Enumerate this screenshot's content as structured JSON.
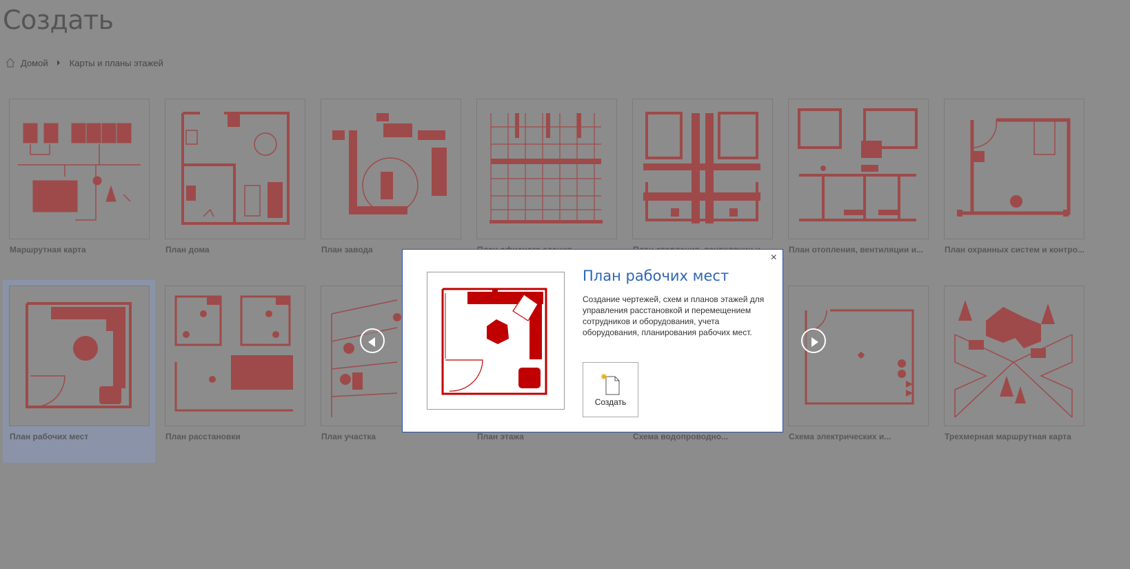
{
  "page": {
    "title": "Создать"
  },
  "breadcrumb": {
    "home": "Домой",
    "current": "Карты и планы этажей"
  },
  "templates": [
    {
      "label": "Маршрутная карта"
    },
    {
      "label": "План дома"
    },
    {
      "label": "План завода"
    },
    {
      "label": "План офисного здания"
    },
    {
      "label": "План отопления, вентиляции и..."
    },
    {
      "label": "План отопления, вентиляции и..."
    },
    {
      "label": "План охранных систем и контро..."
    },
    {
      "label": "План рабочих мест"
    },
    {
      "label": "План расстановки"
    },
    {
      "label": "План участка"
    },
    {
      "label": "План этажа"
    },
    {
      "label": "Схема водопроводно..."
    },
    {
      "label": "Схема электрических и..."
    },
    {
      "label": "Трехмерная маршрутная карта"
    }
  ],
  "dialog": {
    "title": "План рабочих мест",
    "description": "Создание чертежей, схем и планов этажей для управления расстановкой и перемещением сотрудников и оборудования, учета оборудования, планирования рабочих мест.",
    "create_label": "Создать",
    "close_symbol": "×"
  },
  "colors": {
    "accent": "#2e66b5",
    "tile_art": "#9e4a4a",
    "preview_art": "#c00000",
    "overlay": "#8c8c8c"
  }
}
